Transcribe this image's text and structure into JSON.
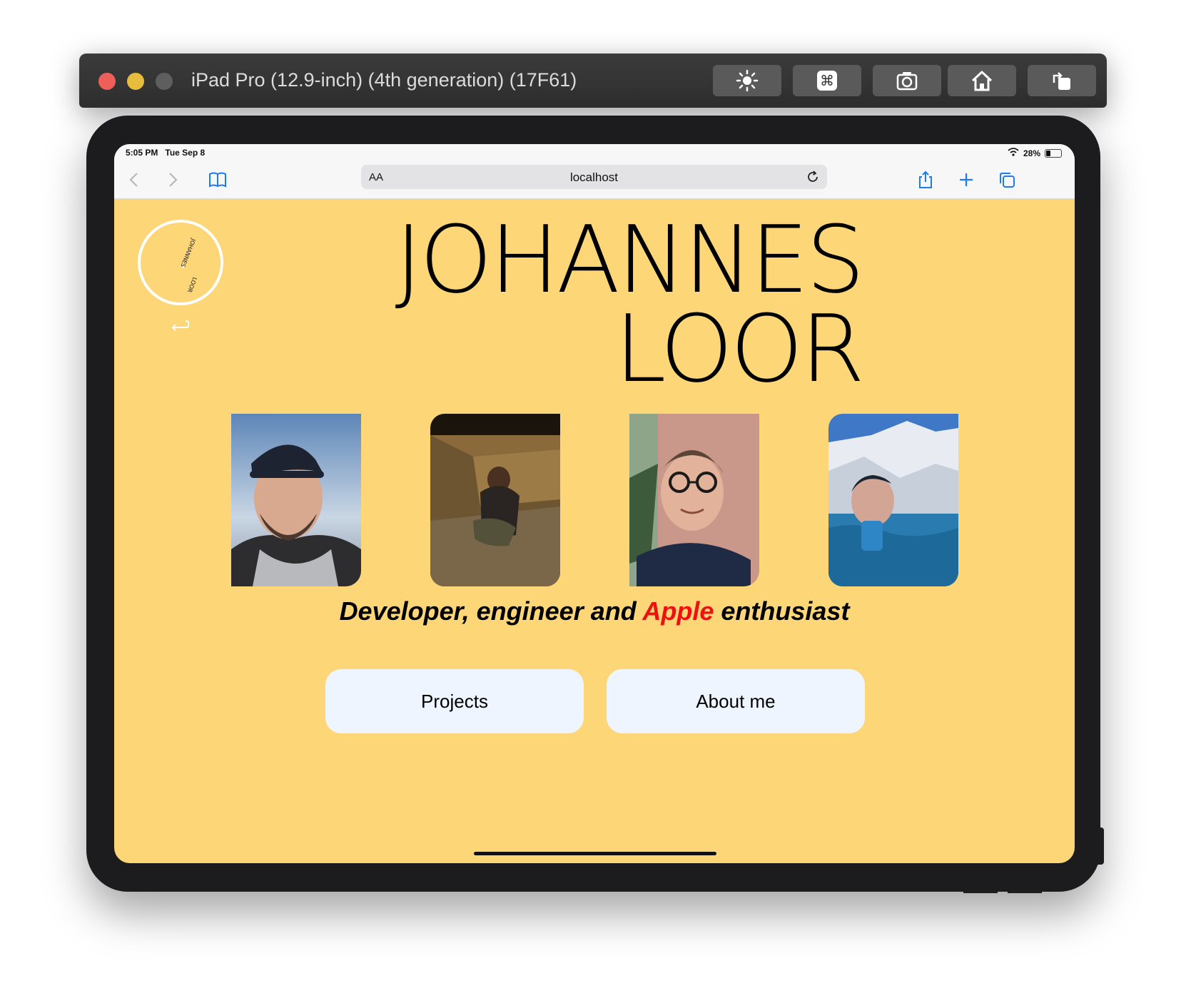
{
  "simulator": {
    "title": "iPad Pro (12.9-inch) (4th generation) (17F61)",
    "buttons": [
      "brightness-icon",
      "command-icon",
      "screenshot-icon",
      "home-icon",
      "rotate-icon"
    ]
  },
  "status_bar": {
    "time": "5:05 PM",
    "date": "Tue Sep 8",
    "battery": "28%"
  },
  "browser": {
    "text_size_label": "AA",
    "url": "localhost"
  },
  "page": {
    "logo_text_top": "JOHANNES",
    "logo_text_bottom": "LOOR",
    "name_line1": "JOHANNES",
    "name_line2": "LOOR",
    "tagline_part1": "Developer, engineer and ",
    "tagline_highlight": "Apple",
    "tagline_part2": " enthusiast",
    "highlight_color": "#ee1111",
    "background_color": "#fdd678",
    "buttons": {
      "projects": "Projects",
      "about": "About me"
    }
  }
}
